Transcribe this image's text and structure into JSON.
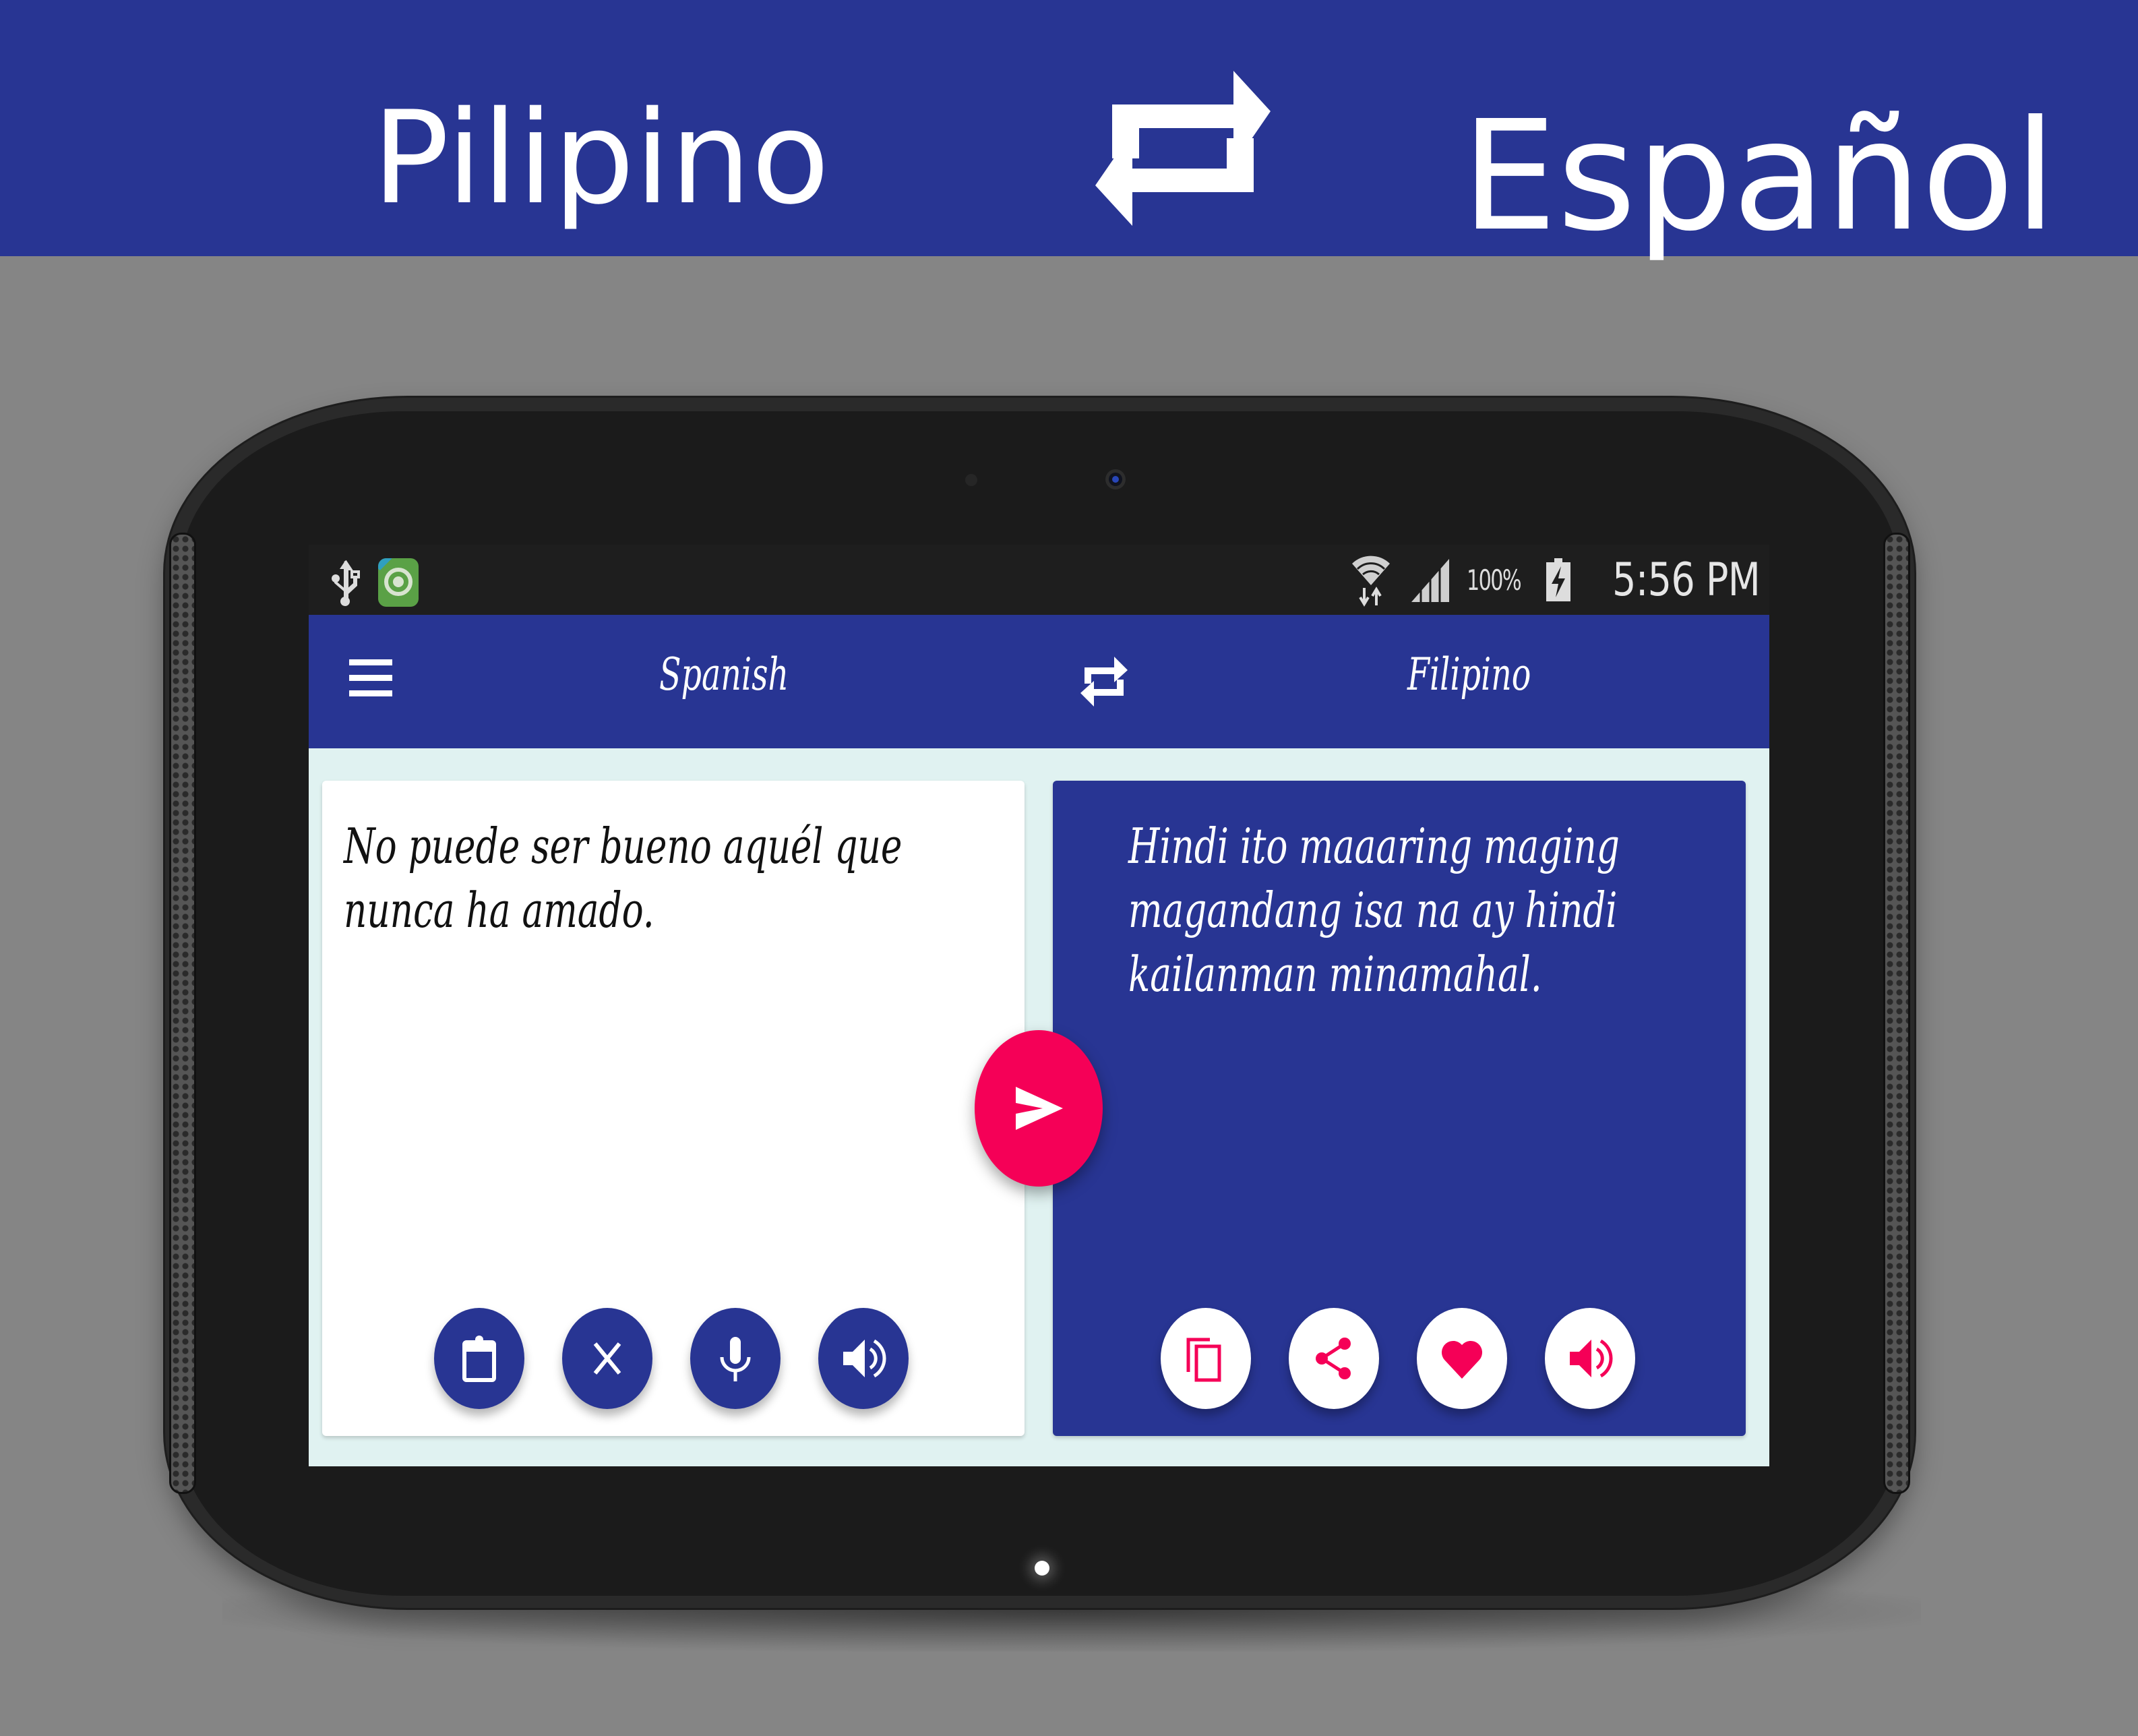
{
  "banner": {
    "source_language": "Pilipino",
    "target_language": "Español",
    "swap_icon": "swap-arrows-icon",
    "background_color": "#283593"
  },
  "statusbar": {
    "left_icons": [
      "usb-icon",
      "app-notification-icon"
    ],
    "wifi_icon": "wifi-icon",
    "signal_icon": "cell-signal-icon",
    "battery_percent": "100%",
    "battery_icon": "battery-charging-icon",
    "time": "5:56 PM"
  },
  "appbar": {
    "menu_icon": "hamburger-menu-icon",
    "source_language": "Spanish",
    "swap_icon": "swap-arrows-icon",
    "target_language": "Filipino",
    "color": "#283593"
  },
  "source_card": {
    "text": "No puede ser bueno aquél que nunca ha amado.",
    "actions": [
      {
        "name": "paste",
        "icon": "clipboard-icon"
      },
      {
        "name": "clear",
        "icon": "close-icon"
      },
      {
        "name": "voice-input",
        "icon": "microphone-icon"
      },
      {
        "name": "speak",
        "icon": "speaker-icon"
      }
    ]
  },
  "translate_button": {
    "icon": "send-icon",
    "color": "#f50057"
  },
  "target_card": {
    "text": "Hindi ito maaaring maging magandang isa na ay hindi kailanman minamahal.",
    "actions": [
      {
        "name": "copy",
        "icon": "copy-icon"
      },
      {
        "name": "share",
        "icon": "share-icon"
      },
      {
        "name": "favorite",
        "icon": "heart-icon"
      },
      {
        "name": "speak",
        "icon": "speaker-icon"
      }
    ],
    "accent_color": "#f50057"
  }
}
